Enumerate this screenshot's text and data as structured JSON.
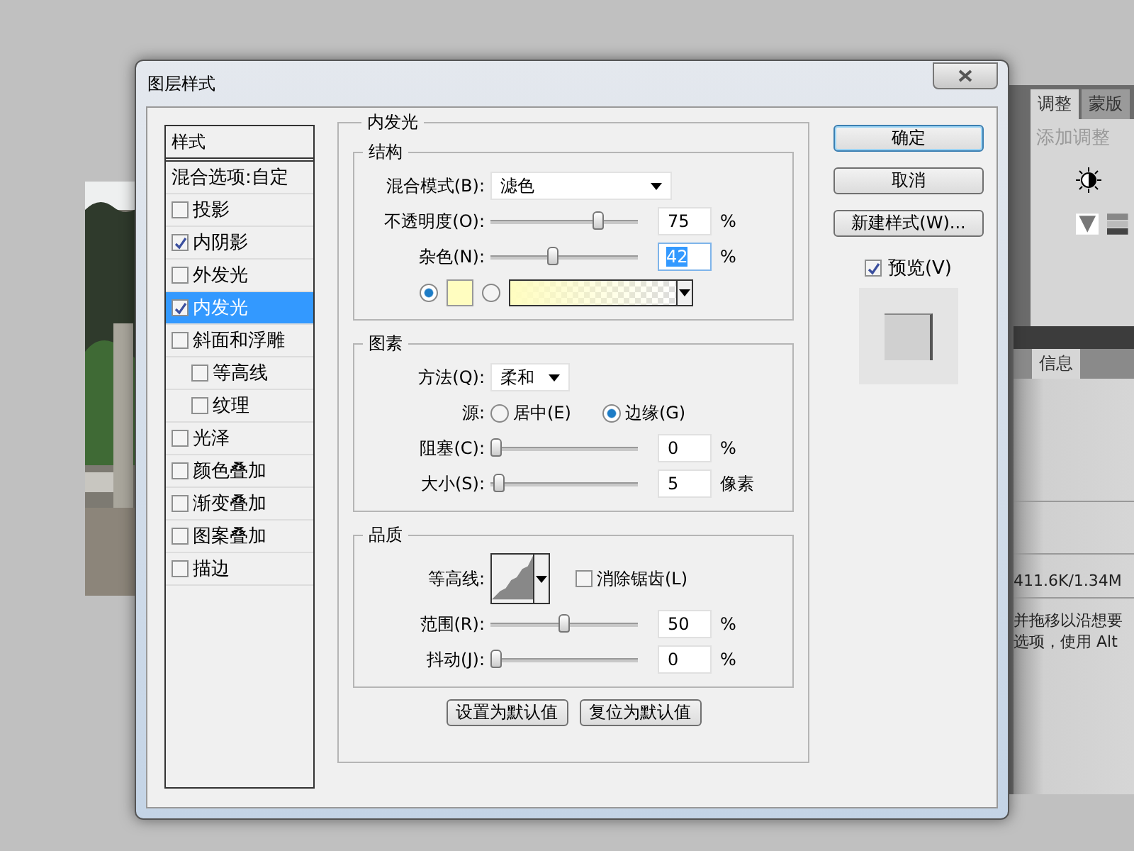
{
  "window": {
    "title": "图层样式"
  },
  "styles": {
    "header": "样式",
    "blend_options": "混合选项:自定",
    "items": [
      {
        "label": "投影",
        "checked": false,
        "selected": false
      },
      {
        "label": "内阴影",
        "checked": true,
        "selected": false
      },
      {
        "label": "外发光",
        "checked": false,
        "selected": false
      },
      {
        "label": "内发光",
        "checked": true,
        "selected": true
      },
      {
        "label": "斜面和浮雕",
        "checked": false,
        "selected": false,
        "children": [
          {
            "label": "等高线",
            "checked": false,
            "selected": false
          },
          {
            "label": "纹理",
            "checked": false,
            "selected": false
          }
        ]
      },
      {
        "label": "光泽",
        "checked": false,
        "selected": false
      },
      {
        "label": "颜色叠加",
        "checked": false,
        "selected": false
      },
      {
        "label": "渐变叠加",
        "checked": false,
        "selected": false
      },
      {
        "label": "图案叠加",
        "checked": false,
        "selected": false
      },
      {
        "label": "描边",
        "checked": false,
        "selected": false
      }
    ]
  },
  "panel": {
    "title": "内发光",
    "structure": {
      "title": "结构",
      "blend_mode": {
        "label": "混合模式(B):",
        "value": "滤色"
      },
      "sliders": [
        {
          "label": "不透明度(O):",
          "level": 0.75,
          "value": "75",
          "unit": "%",
          "highlighted": false
        },
        {
          "label": "杂色(N):",
          "level": 0.42,
          "value": "42",
          "unit": "%",
          "highlighted": true
        }
      ],
      "fill": [
        {
          "kind": "color",
          "selected": true,
          "color": "#fffdc0"
        },
        {
          "kind": "gradient",
          "selected": false
        }
      ]
    },
    "elements": {
      "title": "图素",
      "technique": {
        "label": "方法(Q):",
        "value": "柔和"
      },
      "source": {
        "label": "源:",
        "options": [
          {
            "label": "居中(E)",
            "selected": false
          },
          {
            "label": "边缘(G)",
            "selected": true
          }
        ]
      },
      "sliders": [
        {
          "label": "阻塞(C):",
          "level": 0,
          "value": "0",
          "unit": "%",
          "highlighted": false
        },
        {
          "label": "大小(S):",
          "level": 0.02,
          "value": "5",
          "unit": "像素",
          "highlighted": false
        }
      ]
    },
    "quality": {
      "title": "品质",
      "contour": {
        "label": "等高线:"
      },
      "anti_alias": {
        "label": "消除锯齿(L)",
        "checked": false
      },
      "sliders": [
        {
          "label": "范围(R):",
          "level": 0.5,
          "value": "50",
          "unit": "%",
          "highlighted": false
        },
        {
          "label": "抖动(J):",
          "level": 0,
          "value": "0",
          "unit": "%",
          "highlighted": false
        }
      ]
    },
    "buttons": [
      "设置为默认值",
      "复位为默认值"
    ]
  },
  "actions": {
    "buttons": [
      {
        "label": "确定",
        "default": true
      },
      {
        "label": "取消",
        "default": false
      },
      {
        "label": "新建样式(W)...",
        "default": false
      }
    ],
    "preview": {
      "label": "预览(V)",
      "checked": true
    }
  },
  "background_panel": {
    "tabs": [
      {
        "label": "调整",
        "selected": true
      },
      {
        "label": "蒙版",
        "selected": false
      }
    ],
    "subtitle": "添加调整",
    "info_tab": "信息",
    "doc_size": "411.6K/1.34M",
    "hint_lines": [
      "并拖移以沿想要",
      "选项，使用 Alt"
    ]
  }
}
